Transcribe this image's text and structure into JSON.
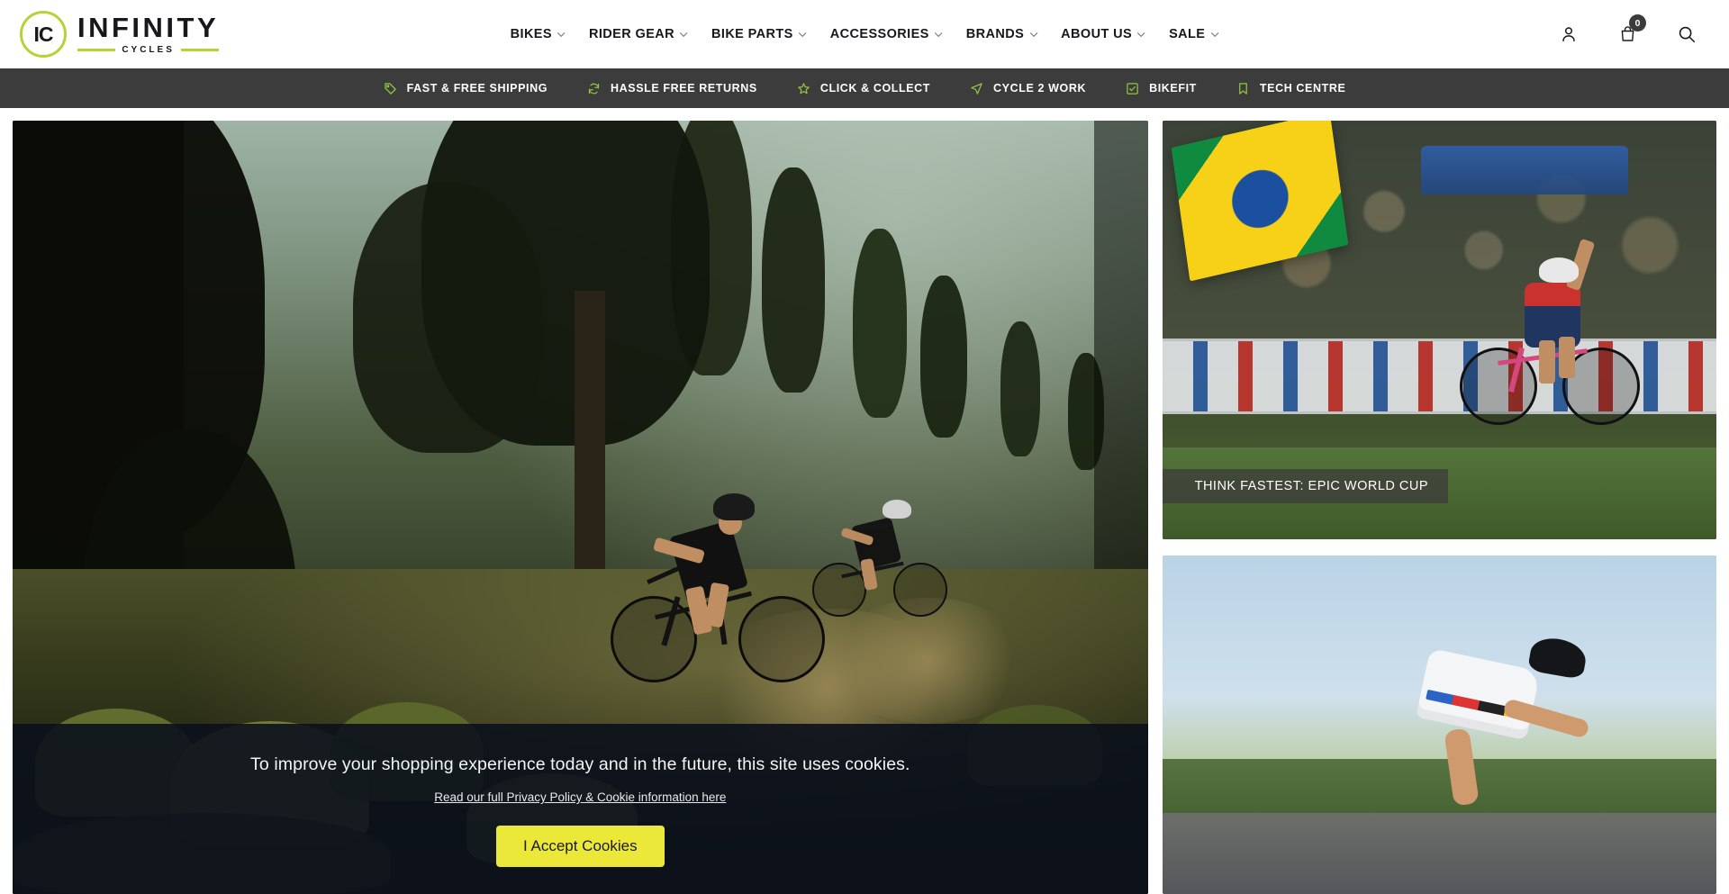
{
  "brand": {
    "badge": "IC",
    "name": "INFINITY",
    "tagline": "CYCLES",
    "accent_color": "#b5d334"
  },
  "nav": {
    "items": [
      {
        "label": "BIKES",
        "has_dropdown": true
      },
      {
        "label": "RIDER GEAR",
        "has_dropdown": true
      },
      {
        "label": "BIKE PARTS",
        "has_dropdown": true
      },
      {
        "label": "ACCESSORIES",
        "has_dropdown": true
      },
      {
        "label": "BRANDS",
        "has_dropdown": true
      },
      {
        "label": "ABOUT US",
        "has_dropdown": true
      },
      {
        "label": "SALE",
        "has_dropdown": true
      }
    ]
  },
  "header_actions": {
    "account_icon": "user-icon",
    "cart_icon": "shopping-bag-icon",
    "cart_count": "0",
    "search_icon": "search-icon"
  },
  "announcement": {
    "background_color": "#3c3c3c",
    "icon_color": "#8dc63f",
    "items": [
      {
        "icon": "tag-icon",
        "label": "FAST & FREE SHIPPING"
      },
      {
        "icon": "refresh-icon",
        "label": "HASSLE FREE RETURNS"
      },
      {
        "icon": "star-icon",
        "label": "CLICK & COLLECT"
      },
      {
        "icon": "paper-plane-icon",
        "label": "CYCLE 2 WORK"
      },
      {
        "icon": "check-square-icon",
        "label": "BIKEFIT"
      },
      {
        "icon": "bookmark-icon",
        "label": "TECH CENTRE"
      }
    ]
  },
  "hero": {
    "alt": "Two mountain bikers riding a forest singletrack trail at golden hour"
  },
  "promos": [
    {
      "alt": "Cyclist celebrating a win at a World Cup cross-country race with Brazilian flag in crowd",
      "caption": "THINK FASTEST: EPIC WORLD CUP"
    },
    {
      "alt": "Road cyclist in rainbow world champion jersey riding on open road",
      "caption": ""
    }
  ],
  "cookie_banner": {
    "message": "To improve your shopping experience today and in the future, this site uses cookies.",
    "link_text": "Read our full Privacy Policy & Cookie information here",
    "accept_label": "I Accept Cookies",
    "button_color": "#ece83a"
  }
}
